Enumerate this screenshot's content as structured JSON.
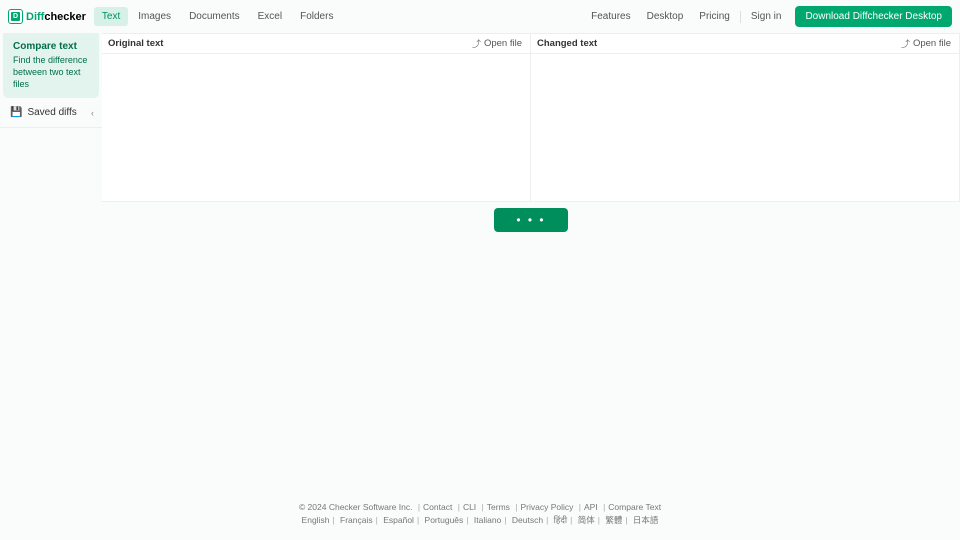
{
  "header": {
    "logo_diff": "Diff",
    "logo_checker": "checker",
    "logo_letter": "D",
    "tabs": [
      "Text",
      "Images",
      "Documents",
      "Excel",
      "Folders"
    ],
    "active_tab": 0,
    "links": [
      "Features",
      "Desktop",
      "Pricing",
      "Sign in"
    ],
    "download_label": "Download Diffchecker Desktop"
  },
  "sidebar": {
    "compare_title": "Compare text",
    "compare_desc": "Find the difference between two text files",
    "saved_label": "Saved diffs",
    "saved_icon": "💾"
  },
  "panes": {
    "original_label": "Original text",
    "changed_label": "Changed text",
    "open_file_label": "Open file",
    "original_value": "",
    "changed_value": ""
  },
  "compare": {
    "button_dots": "• • •"
  },
  "footer": {
    "copyright": "© 2024 Checker Software Inc.",
    "links": [
      "Contact",
      "CLI",
      "Terms",
      "Privacy Policy",
      "API",
      "Compare Text"
    ],
    "langs": [
      "English",
      "Français",
      "Español",
      "Português",
      "Italiano",
      "Deutsch",
      "हिंदी",
      "简体",
      "繁體",
      "日本語"
    ]
  }
}
